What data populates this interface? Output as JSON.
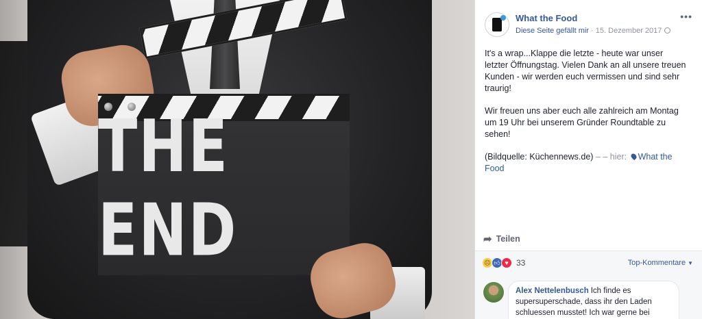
{
  "photo": {
    "clapperboard_text": "THE END"
  },
  "post": {
    "page_name": "What the Food",
    "like_link": "Diese Seite gefällt mir",
    "separator": " · ",
    "date": "15. Dezember 2017",
    "paragraph1": "It's a wrap...Klappe die letzte - heute war unser letzter Öffnungstag. Vielen Dank an all unsere treuen Kunden - wir werden euch vermissen und sind sehr traurig!",
    "paragraph2": "Wir freuen uns aber euch alle zahlreich am Montag um 19 Uhr bei unserem Gründer Roundtable zu sehen!",
    "paragraph3_prefix": "(Bildquelle: Küchennews.de)",
    "paragraph3_hier": " – – hier: ",
    "location": "What the Food",
    "more_icon_glyph": "•••"
  },
  "actions": {
    "share_label": "Teilen",
    "share_icon": "share-arrow-icon"
  },
  "reactions": {
    "count": "33",
    "types": [
      "sad",
      "like",
      "love"
    ],
    "top_comments_label": "Top-Kommentare"
  },
  "comments": [
    {
      "author": "Alex Nettelenbusch",
      "text": "Ich finde es supersuperschade, dass ihr den Laden schluessen musstet! Ich war gerne bei"
    }
  ],
  "colors": {
    "link": "#365899",
    "meta": "#90949c",
    "text": "#1d2129",
    "panel_bg": "#ffffff",
    "footer_bg": "#f6f7f9"
  }
}
